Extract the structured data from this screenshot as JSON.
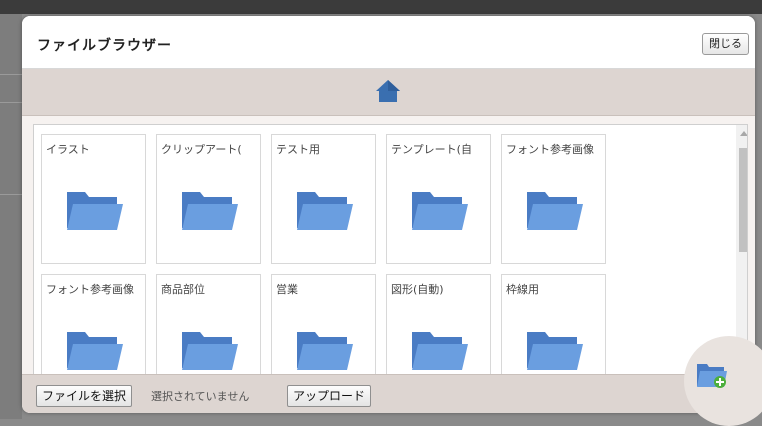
{
  "dialog": {
    "title": "ファイルブラウザー",
    "close_label": "閉じる"
  },
  "toolbar": {
    "home_icon": "home-icon"
  },
  "folders": [
    {
      "label": "イラスト"
    },
    {
      "label": "クリップアート("
    },
    {
      "label": "テスト用"
    },
    {
      "label": "テンプレート(自"
    },
    {
      "label": "フォント参考画像"
    },
    {
      "label": "フォント参考画像"
    },
    {
      "label": "商品部位"
    },
    {
      "label": "営業"
    },
    {
      "label": "図形(自動)"
    },
    {
      "label": "枠線用"
    }
  ],
  "footer": {
    "choose_file_label": "ファイルを選択",
    "no_file_text": "選択されていません",
    "upload_label": "アップロード",
    "new_folder_icon": "new-folder-icon"
  },
  "colors": {
    "folder": "#5b8fd6",
    "home": "#3a6fb0",
    "bar": "#ddd5d1"
  }
}
